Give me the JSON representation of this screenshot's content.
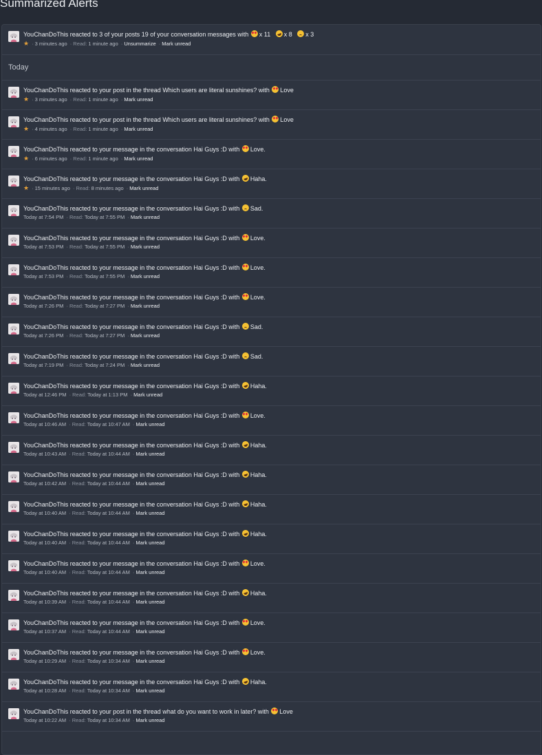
{
  "page": {
    "title": "Summarized Alerts"
  },
  "summary": {
    "user": "YouChanDoThis",
    "text": "reacted to 3 of your posts 19 of your conversation messages with",
    "reactions": [
      {
        "emoji": "love",
        "count": "x 11"
      },
      {
        "emoji": "haha",
        "count": "x 8"
      },
      {
        "emoji": "sad",
        "count": "x 3"
      }
    ],
    "time": "3 minutes ago",
    "read_label": "Read:",
    "read_time": "1 minute ago",
    "action1": "Unsummarize",
    "action2": "Mark unread"
  },
  "section_label": "Today",
  "alerts": [
    {
      "user": "YouChanDoThis",
      "text": "reacted to your post in the thread Which users are literal sunshines? with",
      "emoji": "love",
      "reaction": "Love",
      "starred": true,
      "time": "3 minutes ago",
      "read": "1 minute ago",
      "action": "Mark unread"
    },
    {
      "user": "YouChanDoThis",
      "text": "reacted to your post in the thread Which users are literal sunshines? with",
      "emoji": "love",
      "reaction": "Love",
      "starred": true,
      "time": "4 minutes ago",
      "read": "1 minute ago",
      "action": "Mark unread"
    },
    {
      "user": "YouChanDoThis",
      "text": "reacted to your message in the conversation Hai Guys :D with",
      "emoji": "love",
      "reaction": "Love.",
      "starred": true,
      "time": "6 minutes ago",
      "read": "1 minute ago",
      "action": "Mark unread"
    },
    {
      "user": "YouChanDoThis",
      "text": "reacted to your message in the conversation Hai Guys :D with",
      "emoji": "haha",
      "reaction": "Haha.",
      "starred": true,
      "time": "15 minutes ago",
      "read": "8 minutes ago",
      "action": "Mark unread"
    },
    {
      "user": "YouChanDoThis",
      "text": "reacted to your message in the conversation Hai Guys :D with",
      "emoji": "sad",
      "reaction": "Sad.",
      "starred": false,
      "time": "Today at 7:54 PM",
      "read": "Today at 7:55 PM",
      "action": "Mark unread"
    },
    {
      "user": "YouChanDoThis",
      "text": "reacted to your message in the conversation Hai Guys :D with",
      "emoji": "love",
      "reaction": "Love.",
      "starred": false,
      "time": "Today at 7:53 PM",
      "read": "Today at 7:55 PM",
      "action": "Mark unread"
    },
    {
      "user": "YouChanDoThis",
      "text": "reacted to your message in the conversation Hai Guys :D with",
      "emoji": "love",
      "reaction": "Love.",
      "starred": false,
      "time": "Today at 7:53 PM",
      "read": "Today at 7:55 PM",
      "action": "Mark unread"
    },
    {
      "user": "YouChanDoThis",
      "text": "reacted to your message in the conversation Hai Guys :D with",
      "emoji": "love",
      "reaction": "Love.",
      "starred": false,
      "time": "Today at 7:26 PM",
      "read": "Today at 7:27 PM",
      "action": "Mark unread"
    },
    {
      "user": "YouChanDoThis",
      "text": "reacted to your message in the conversation Hai Guys :D with",
      "emoji": "sad",
      "reaction": "Sad.",
      "starred": false,
      "time": "Today at 7:26 PM",
      "read": "Today at 7:27 PM",
      "action": "Mark unread"
    },
    {
      "user": "YouChanDoThis",
      "text": "reacted to your message in the conversation Hai Guys :D with",
      "emoji": "sad",
      "reaction": "Sad.",
      "starred": false,
      "time": "Today at 7:19 PM",
      "read": "Today at 7:24 PM",
      "action": "Mark unread"
    },
    {
      "user": "YouChanDoThis",
      "text": "reacted to your message in the conversation Hai Guys :D with",
      "emoji": "haha",
      "reaction": "Haha.",
      "starred": false,
      "time": "Today at 12:46 PM",
      "read": "Today at 1:13 PM",
      "action": "Mark unread"
    },
    {
      "user": "YouChanDoThis",
      "text": "reacted to your message in the conversation Hai Guys :D with",
      "emoji": "love",
      "reaction": "Love.",
      "starred": false,
      "time": "Today at 10:46 AM",
      "read": "Today at 10:47 AM",
      "action": "Mark unread"
    },
    {
      "user": "YouChanDoThis",
      "text": "reacted to your message in the conversation Hai Guys :D with",
      "emoji": "haha",
      "reaction": "Haha.",
      "starred": false,
      "time": "Today at 10:43 AM",
      "read": "Today at 10:44 AM",
      "action": "Mark unread"
    },
    {
      "user": "YouChanDoThis",
      "text": "reacted to your message in the conversation Hai Guys :D with",
      "emoji": "haha",
      "reaction": "Haha.",
      "starred": false,
      "time": "Today at 10:42 AM",
      "read": "Today at 10:44 AM",
      "action": "Mark unread"
    },
    {
      "user": "YouChanDoThis",
      "text": "reacted to your message in the conversation Hai Guys :D with",
      "emoji": "haha",
      "reaction": "Haha.",
      "starred": false,
      "time": "Today at 10:40 AM",
      "read": "Today at 10:44 AM",
      "action": "Mark unread"
    },
    {
      "user": "YouChanDoThis",
      "text": "reacted to your message in the conversation Hai Guys :D with",
      "emoji": "haha",
      "reaction": "Haha.",
      "starred": false,
      "time": "Today at 10:40 AM",
      "read": "Today at 10:44 AM",
      "action": "Mark unread"
    },
    {
      "user": "YouChanDoThis",
      "text": "reacted to your message in the conversation Hai Guys :D with",
      "emoji": "love",
      "reaction": "Love.",
      "starred": false,
      "time": "Today at 10:40 AM",
      "read": "Today at 10:44 AM",
      "action": "Mark unread"
    },
    {
      "user": "YouChanDoThis",
      "text": "reacted to your message in the conversation Hai Guys :D with",
      "emoji": "haha",
      "reaction": "Haha.",
      "starred": false,
      "time": "Today at 10:39 AM",
      "read": "Today at 10:44 AM",
      "action": "Mark unread"
    },
    {
      "user": "YouChanDoThis",
      "text": "reacted to your message in the conversation Hai Guys :D with",
      "emoji": "love",
      "reaction": "Love.",
      "starred": false,
      "time": "Today at 10:37 AM",
      "read": "Today at 10:44 AM",
      "action": "Mark unread"
    },
    {
      "user": "YouChanDoThis",
      "text": "reacted to your message in the conversation Hai Guys :D with",
      "emoji": "love",
      "reaction": "Love.",
      "starred": false,
      "time": "Today at 10:29 AM",
      "read": "Today at 10:34 AM",
      "action": "Mark unread"
    },
    {
      "user": "YouChanDoThis",
      "text": "reacted to your message in the conversation Hai Guys :D with",
      "emoji": "haha",
      "reaction": "Haha.",
      "starred": false,
      "time": "Today at 10:28 AM",
      "read": "Today at 10:34 AM",
      "action": "Mark unread"
    },
    {
      "user": "YouChanDoThis",
      "text": "reacted to your post in the thread what do you want to work in later? with",
      "emoji": "love",
      "reaction": "Love",
      "starred": false,
      "time": "Today at 10:22 AM",
      "read": "Today at 10:34 AM",
      "action": "Mark unread"
    }
  ],
  "read_label": "Read:",
  "colors": {
    "background": "#252a34",
    "panel": "#2e3440",
    "star": "#e7a23b"
  }
}
